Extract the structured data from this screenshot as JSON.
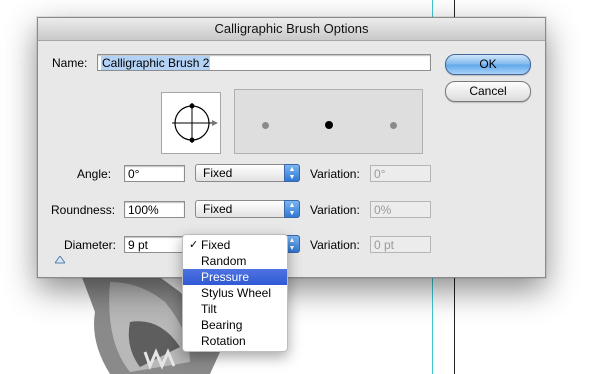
{
  "dialog": {
    "title": "Calligraphic Brush Options",
    "name_label": "Name:",
    "name_value": "Calligraphic Brush 2",
    "ok_label": "OK",
    "cancel_label": "Cancel"
  },
  "rows": {
    "angle": {
      "label": "Angle:",
      "value": "0°",
      "mode": "Fixed",
      "variation_label": "Variation:",
      "variation_value": "0°"
    },
    "roundness": {
      "label": "Roundness:",
      "value": "100%",
      "mode": "Fixed",
      "variation_label": "Variation:",
      "variation_value": "0%"
    },
    "diameter": {
      "label": "Diameter:",
      "value": "9 pt",
      "variation_label": "Variation:",
      "variation_value": "0 pt"
    }
  },
  "menu": {
    "selected": "Fixed",
    "highlighted": "Pressure",
    "items": [
      "Fixed",
      "Random",
      "Pressure",
      "Stylus Wheel",
      "Tilt",
      "Bearing",
      "Rotation"
    ]
  },
  "colors": {
    "accent": "#3b73e0",
    "guide": "#3fc9d6"
  }
}
